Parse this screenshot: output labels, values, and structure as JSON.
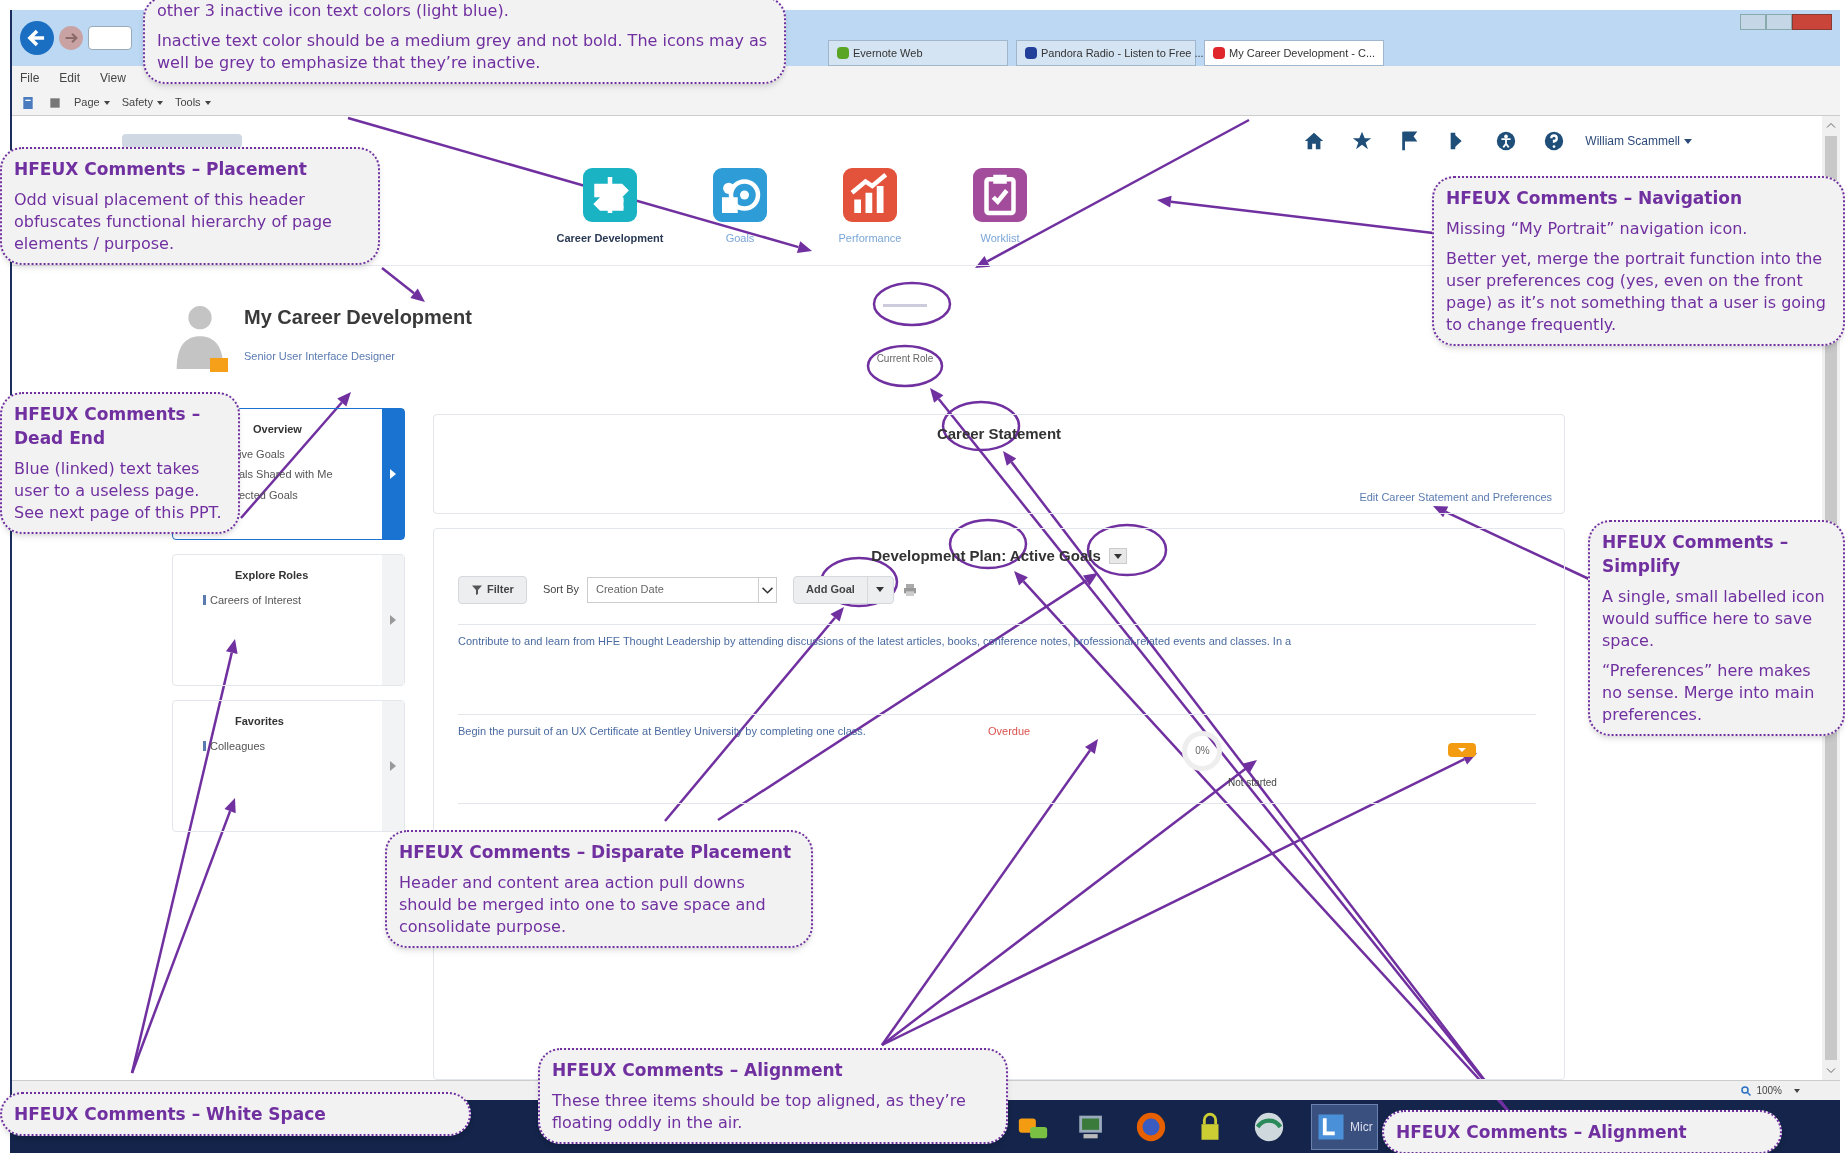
{
  "browser": {
    "tabs": [
      {
        "label": "Evernote Web",
        "kind": "evernote",
        "selected": false
      },
      {
        "label": "Pandora Radio - Listen to Free ...",
        "kind": "pandora",
        "selected": false
      },
      {
        "label": "My Career Development - C...",
        "kind": "oracle",
        "selected": true
      }
    ],
    "menu": [
      "File",
      "Edit",
      "View"
    ],
    "command_bar": [
      "Page",
      "Safety",
      "Tools"
    ],
    "zoom": "100%"
  },
  "app": {
    "user_name": "William Scammell",
    "nav_icons": [
      {
        "label": "Career Development",
        "kind": "career",
        "selected": true
      },
      {
        "label": "Goals",
        "kind": "goals",
        "selected": false
      },
      {
        "label": "Performance",
        "kind": "performance",
        "selected": false
      },
      {
        "label": "Worklist",
        "kind": "worklist",
        "selected": false
      }
    ],
    "title": "My Career Development",
    "job_title": "Senior User Interface Designer",
    "current_role": "Current Role",
    "side_cards": [
      {
        "title": "Overview",
        "selected": true,
        "links": [
          "ive Goals",
          "als Shared with Me",
          "ected Goals"
        ]
      },
      {
        "title": "Explore Roles",
        "selected": false,
        "links": [
          "Careers of Interest"
        ]
      },
      {
        "title": "Favorites",
        "selected": false,
        "links": [
          "Colleagues"
        ]
      }
    ],
    "career_statement": {
      "title": "Career Statement",
      "link": "Edit Career Statement and Preferences"
    },
    "plan": {
      "title": "Development Plan: Active Goals",
      "filter": "Filter",
      "sort_label": "Sort By",
      "sort_value": "Creation Date",
      "add_button": "Add Goal",
      "goals": [
        {
          "title": "Contribute to and learn from HFE Thought Leadership by attending discussions of the latest articles, books, conference notes, professional-related events and classes. In a"
        },
        {
          "title": "Begin the pursuit of an UX Certificate at Bentley University by completing one class.",
          "status": "Overdue",
          "progress": "0%",
          "progress_label": "Not started"
        }
      ]
    }
  },
  "taskbar": {
    "active_item": "Micr"
  },
  "callouts": [
    {
      "paragraphs": [
        "other 3 inactive icon text colors (light blue).",
        "Inactive text color should be a medium grey and not bold. The icons may as well be grey to emphasize that they’re inactive."
      ]
    },
    {
      "title": "HFEUX Comments – Placement",
      "paragraphs": [
        "Odd visual placement of this header obfuscates functional hierarchy of page elements / purpose."
      ]
    },
    {
      "title": "HFEUX Comments – Dead End",
      "paragraphs": [
        "Blue (linked) text takes user to a useless page. See next page of this PPT."
      ]
    },
    {
      "title": "HFEUX Comments – Navigation",
      "paragraphs": [
        "Missing “My Portrait” navigation icon.",
        "Better yet, merge the portrait function into the user preferences cog (yes, even on the front page) as it’s not something that a user is going to change frequently."
      ]
    },
    {
      "title": "HFEUX Comments – Simplify",
      "paragraphs": [
        "A single, small labelled icon would suffice here to save space.",
        "“Preferences” here makes no sense. Merge into main preferences."
      ]
    },
    {
      "title": "HFEUX Comments – Disparate Placement",
      "paragraphs": [
        "Header and content area action pull downs should be merged into one to save space and consolidate purpose."
      ]
    },
    {
      "title": "HFEUX Comments – White Space"
    },
    {
      "title": "HFEUX Comments – Alignment",
      "paragraphs": [
        "These three items should be top aligned, as they’re floating oddly in the air."
      ]
    },
    {
      "title": "HFEUX Comments – Alignment"
    }
  ]
}
